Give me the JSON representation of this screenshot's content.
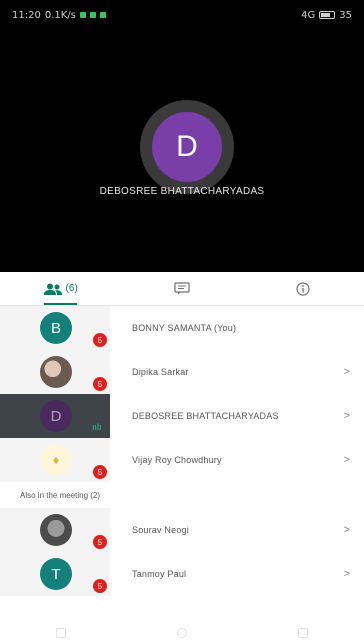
{
  "status_bar": {
    "time": "11:20",
    "left_info": "0.1K/s",
    "right_info": "4G",
    "battery": "35"
  },
  "speaker": {
    "initial": "D",
    "name": "DEBOSREE BHATTACHARYADAS"
  },
  "tabs": [
    {
      "name": "participants",
      "count": "(6)"
    },
    {
      "name": "chat"
    },
    {
      "name": "info"
    }
  ],
  "participants": [
    {
      "name": "BONNY SAMANTA (You)",
      "initial": "B",
      "badge": "5",
      "chevron": ""
    },
    {
      "name": "Dipika Sarkar",
      "initial": "",
      "badge": "5",
      "chevron": ">"
    },
    {
      "name": "DEBOSREE BHATTACHARYADAS",
      "initial": "D",
      "badge": "",
      "chevron": ">"
    },
    {
      "name": "Vijay Roy Chowdhury",
      "initial": "♦",
      "badge": "5",
      "chevron": ">"
    }
  ],
  "also_section": {
    "title": "Also in the meeting (2)"
  },
  "also_participants": [
    {
      "name": "Sourav Neogi",
      "initial": "",
      "badge": "5",
      "chevron": ">"
    },
    {
      "name": "Tanmoy Paul",
      "initial": "T",
      "badge": "5",
      "chevron": ">"
    }
  ],
  "colors": {
    "accent": "#0a7a62",
    "badge": "#e0201d",
    "speaker_avatar": "#7a3ea8"
  }
}
